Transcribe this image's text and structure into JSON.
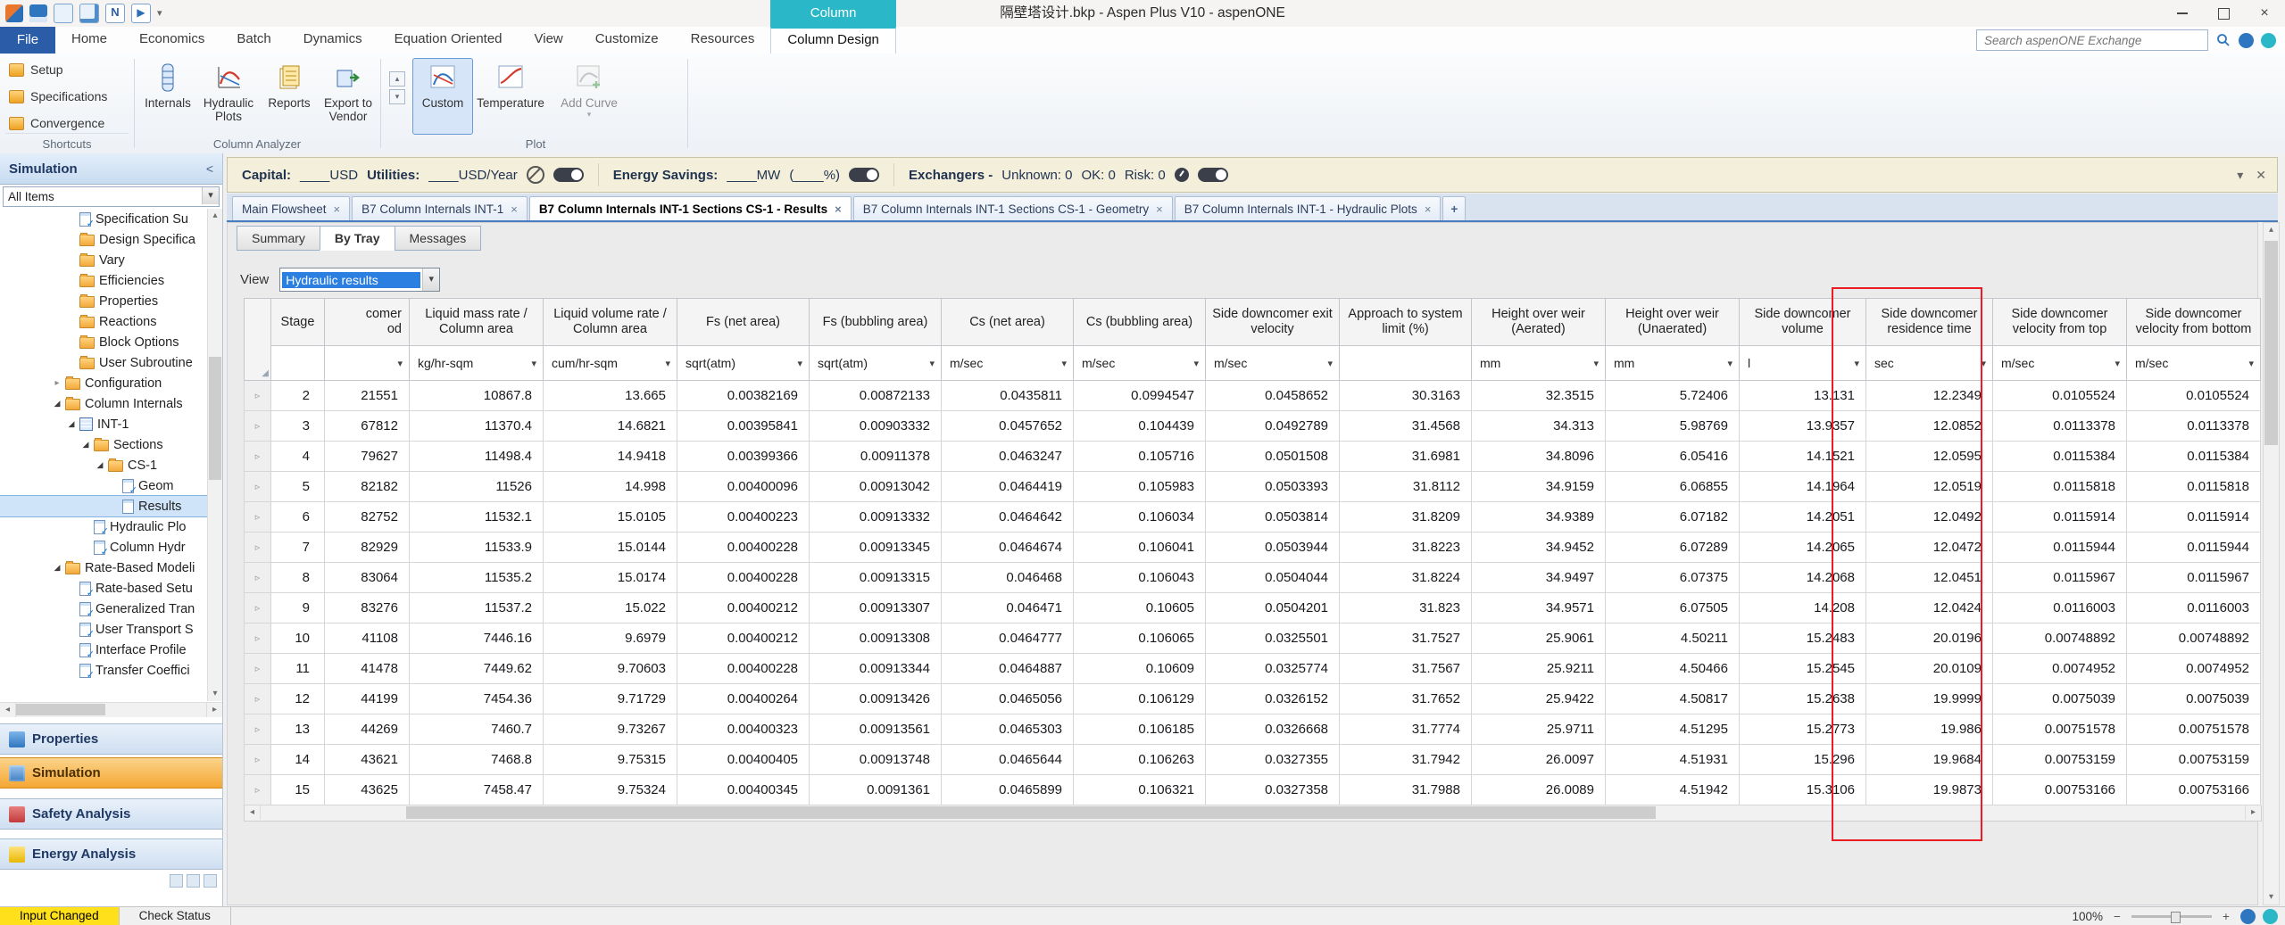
{
  "colors": {
    "contextual_tab_teal": "#2ab7c8",
    "file_tab_blue": "#2a5ca8",
    "active_environment_orange": "#f5a733",
    "annotation_red": "#ec1c24",
    "status_input_changed_yellow": "#ffe01a",
    "doc_tab_underline_blue": "#4a7cc0"
  },
  "titlebar": {
    "title": "隔壁塔设计.bkp - Aspen Plus V10 - aspenONE",
    "contextual_group_label": "Column"
  },
  "menubar": {
    "file": "File",
    "tabs": [
      "Home",
      "Economics",
      "Batch",
      "Dynamics",
      "Equation Oriented",
      "View",
      "Customize",
      "Resources"
    ],
    "active_tab": "Column Design",
    "search_placeholder": "Search aspenONE Exchange"
  },
  "ribbon": {
    "shortcuts_group": {
      "label": "Shortcuts",
      "items": [
        "Setup",
        "Specifications",
        "Convergence"
      ]
    },
    "column_analyzer_group": {
      "label": "Column Analyzer",
      "buttons": [
        "Internals",
        "Hydraulic Plots",
        "Reports",
        "Export to Vendor"
      ]
    },
    "plot_group": {
      "label": "Plot",
      "buttons": [
        "Custom",
        "Temperature",
        "Add Curve"
      ]
    }
  },
  "economics_bar": {
    "capital_label": "Capital:",
    "capital_value": "____USD",
    "utilities_label": "Utilities:",
    "utilities_value": "____USD/Year",
    "energy_label": "Energy Savings:",
    "energy_value": "____MW",
    "energy_percent": "(____%)",
    "exchangers_label": "Exchangers -",
    "exchangers_unknown": "Unknown: 0",
    "exchangers_ok": "OK: 0",
    "exchangers_risk": "Risk: 0"
  },
  "sidebar": {
    "header": "Simulation",
    "filter_value": "All Items",
    "tree": [
      {
        "label": "Specification Su",
        "icon": "sheet-check",
        "level": 5
      },
      {
        "label": "Design Specifica",
        "icon": "folder",
        "level": 5
      },
      {
        "label": "Vary",
        "icon": "folder",
        "level": 5
      },
      {
        "label": "Efficiencies",
        "icon": "folder",
        "level": 5
      },
      {
        "label": "Properties",
        "icon": "folder",
        "level": 5
      },
      {
        "label": "Reactions",
        "icon": "folder",
        "level": 5
      },
      {
        "label": "Block Options",
        "icon": "folder",
        "level": 5
      },
      {
        "label": "User Subroutine",
        "icon": "folder",
        "level": 5
      },
      {
        "label": "Configuration",
        "icon": "folder",
        "level": 4,
        "arrow": "collapsed"
      },
      {
        "label": "Column Internals",
        "icon": "folder",
        "level": 4,
        "arrow": "expanded"
      },
      {
        "label": "INT-1",
        "icon": "grid",
        "level": 5,
        "arrow": "expanded"
      },
      {
        "label": "Sections",
        "icon": "folder",
        "level": 6,
        "arrow": "expanded"
      },
      {
        "label": "CS-1",
        "icon": "folder",
        "level": 7,
        "arrow": "expanded"
      },
      {
        "label": "Geom",
        "icon": "sheet-check",
        "level": 8
      },
      {
        "label": "Results",
        "icon": "sheet",
        "level": 8,
        "selected": true
      },
      {
        "label": "Hydraulic Plo",
        "icon": "sheet-check",
        "level": 6
      },
      {
        "label": "Column Hydr",
        "icon": "sheet-check",
        "level": 6
      },
      {
        "label": "Rate-Based Modeli",
        "icon": "folder",
        "level": 4,
        "arrow": "expanded"
      },
      {
        "label": "Rate-based Setu",
        "icon": "sheet-check",
        "level": 5
      },
      {
        "label": "Generalized Tran",
        "icon": "sheet-check",
        "level": 5
      },
      {
        "label": "User Transport S",
        "icon": "sheet-check",
        "level": 5
      },
      {
        "label": "Interface Profile",
        "icon": "sheet-check",
        "level": 5
      },
      {
        "label": "Transfer Coeffici",
        "icon": "sheet-check",
        "level": 5
      }
    ],
    "nav": [
      {
        "label": "Properties"
      },
      {
        "label": "Simulation",
        "active": true
      },
      {
        "label": "Safety Analysis"
      },
      {
        "label": "Energy Analysis"
      }
    ]
  },
  "document_tabs": {
    "tabs": [
      {
        "label": "Main Flowsheet"
      },
      {
        "label": "B7 Column Internals INT-1"
      },
      {
        "label": "B7 Column Internals INT-1 Sections CS-1 - Results",
        "active": true
      },
      {
        "label": "B7 Column Internals INT-1 Sections CS-1 - Geometry"
      },
      {
        "label": "B7 Column Internals INT-1 - Hydraulic Plots"
      }
    ],
    "new_tab_label": "+"
  },
  "subtabs": {
    "items": [
      "Summary",
      "By Tray",
      "Messages"
    ],
    "active": "By Tray"
  },
  "view_selector": {
    "label": "View",
    "value": "Hydraulic results"
  },
  "table": {
    "columns": [
      {
        "label": "Stage"
      },
      {
        "label": "comer",
        "label2": "od",
        "unit": "",
        "dropdown": true
      },
      {
        "label": "Liquid mass rate / Column area",
        "unit": "kg/hr-sqm",
        "dropdown": true
      },
      {
        "label": "Liquid volume rate / Column area",
        "unit": "cum/hr-sqm",
        "dropdown": true
      },
      {
        "label": "Fs (net area)",
        "unit": "sqrt(atm)",
        "dropdown": true
      },
      {
        "label": "Fs (bubbling area)",
        "unit": "sqrt(atm)",
        "dropdown": true
      },
      {
        "label": "Cs (net area)",
        "unit": "m/sec",
        "dropdown": true
      },
      {
        "label": "Cs (bubbling area)",
        "unit": "m/sec",
        "dropdown": true
      },
      {
        "label": "Side downcomer exit velocity",
        "unit": "m/sec",
        "dropdown": true
      },
      {
        "label": "Approach to system limit (%)"
      },
      {
        "label": "Height over weir (Aerated)",
        "unit": "mm",
        "dropdown": true
      },
      {
        "label": "Height over weir (Unaerated)",
        "unit": "mm",
        "dropdown": true
      },
      {
        "label": "Side downcomer volume",
        "unit": "l",
        "dropdown": true
      },
      {
        "label": "Side downcomer residence time",
        "unit": "sec",
        "dropdown": true
      },
      {
        "label": "Side downcomer velocity from top",
        "unit": "m/sec",
        "dropdown": true
      },
      {
        "label": "Side downcomer velocity from bottom",
        "unit": "m/sec",
        "dropdown": true
      }
    ],
    "rows": [
      [
        "2",
        "21551",
        "10867.8",
        "13.665",
        "0.00382169",
        "0.00872133",
        "0.0435811",
        "0.0994547",
        "0.0458652",
        "30.3163",
        "32.3515",
        "5.72406",
        "13.131",
        "12.2349",
        "0.0105524",
        "0.0105524"
      ],
      [
        "3",
        "67812",
        "11370.4",
        "14.6821",
        "0.00395841",
        "0.00903332",
        "0.0457652",
        "0.104439",
        "0.0492789",
        "31.4568",
        "34.313",
        "5.98769",
        "13.9357",
        "12.0852",
        "0.0113378",
        "0.0113378"
      ],
      [
        "4",
        "79627",
        "11498.4",
        "14.9418",
        "0.00399366",
        "0.00911378",
        "0.0463247",
        "0.105716",
        "0.0501508",
        "31.6981",
        "34.8096",
        "6.05416",
        "14.1521",
        "12.0595",
        "0.0115384",
        "0.0115384"
      ],
      [
        "5",
        "82182",
        "11526",
        "14.998",
        "0.00400096",
        "0.00913042",
        "0.0464419",
        "0.105983",
        "0.0503393",
        "31.8112",
        "34.9159",
        "6.06855",
        "14.1964",
        "12.0519",
        "0.0115818",
        "0.0115818"
      ],
      [
        "6",
        "82752",
        "11532.1",
        "15.0105",
        "0.00400223",
        "0.00913332",
        "0.0464642",
        "0.106034",
        "0.0503814",
        "31.8209",
        "34.9389",
        "6.07182",
        "14.2051",
        "12.0492",
        "0.0115914",
        "0.0115914"
      ],
      [
        "7",
        "82929",
        "11533.9",
        "15.0144",
        "0.00400228",
        "0.00913345",
        "0.0464674",
        "0.106041",
        "0.0503944",
        "31.8223",
        "34.9452",
        "6.07289",
        "14.2065",
        "12.0472",
        "0.0115944",
        "0.0115944"
      ],
      [
        "8",
        "83064",
        "11535.2",
        "15.0174",
        "0.00400228",
        "0.00913315",
        "0.046468",
        "0.106043",
        "0.0504044",
        "31.8224",
        "34.9497",
        "6.07375",
        "14.2068",
        "12.0451",
        "0.0115967",
        "0.0115967"
      ],
      [
        "9",
        "83276",
        "11537.2",
        "15.022",
        "0.00400212",
        "0.00913307",
        "0.046471",
        "0.10605",
        "0.0504201",
        "31.823",
        "34.9571",
        "6.07505",
        "14.208",
        "12.0424",
        "0.0116003",
        "0.0116003"
      ],
      [
        "10",
        "41108",
        "7446.16",
        "9.6979",
        "0.00400212",
        "0.00913308",
        "0.0464777",
        "0.106065",
        "0.0325501",
        "31.7527",
        "25.9061",
        "4.50211",
        "15.2483",
        "20.0196",
        "0.00748892",
        "0.00748892"
      ],
      [
        "11",
        "41478",
        "7449.62",
        "9.70603",
        "0.00400228",
        "0.00913344",
        "0.0464887",
        "0.10609",
        "0.0325774",
        "31.7567",
        "25.9211",
        "4.50466",
        "15.2545",
        "20.0109",
        "0.0074952",
        "0.0074952"
      ],
      [
        "12",
        "44199",
        "7454.36",
        "9.71729",
        "0.00400264",
        "0.00913426",
        "0.0465056",
        "0.106129",
        "0.0326152",
        "31.7652",
        "25.9422",
        "4.50817",
        "15.2638",
        "19.9999",
        "0.0075039",
        "0.0075039"
      ],
      [
        "13",
        "44269",
        "7460.7",
        "9.73267",
        "0.00400323",
        "0.00913561",
        "0.0465303",
        "0.106185",
        "0.0326668",
        "31.7774",
        "25.9711",
        "4.51295",
        "15.2773",
        "19.986",
        "0.00751578",
        "0.00751578"
      ],
      [
        "14",
        "43621",
        "7468.8",
        "9.75315",
        "0.00400405",
        "0.00913748",
        "0.0465644",
        "0.106263",
        "0.0327355",
        "31.7942",
        "26.0097",
        "4.51931",
        "15.296",
        "19.9684",
        "0.00753159",
        "0.00753159"
      ],
      [
        "15",
        "43625",
        "7458.47",
        "9.75324",
        "0.00400345",
        "0.0091361",
        "0.0465899",
        "0.106321",
        "0.0327358",
        "31.7988",
        "26.0089",
        "4.51942",
        "15.3106",
        "19.9873",
        "0.00753166",
        "0.00753166"
      ]
    ]
  },
  "status_bar": {
    "input_state": "Input Changed",
    "check_status": "Check Status",
    "zoom": "100%"
  }
}
